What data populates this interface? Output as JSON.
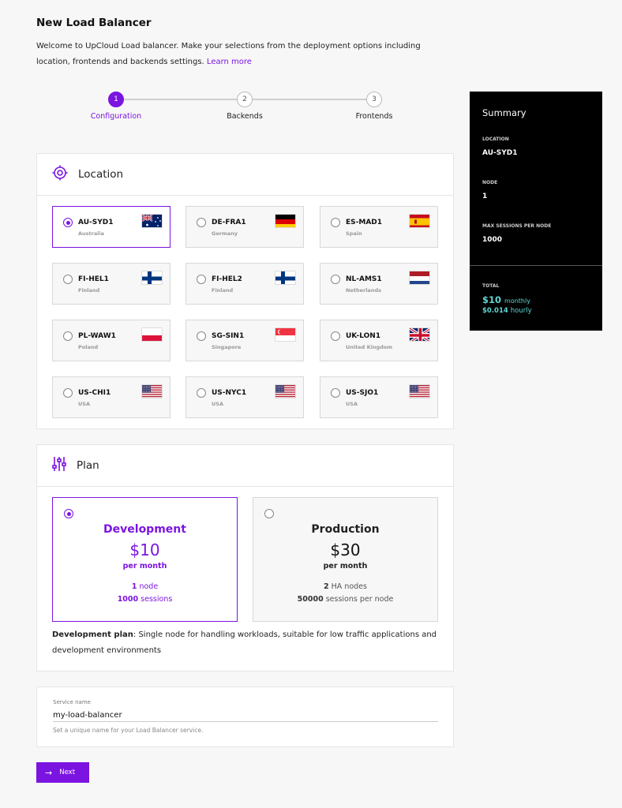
{
  "page": {
    "title": "New Load Balancer",
    "intro": "Welcome to UpCloud Load balancer. Make your selections from the deployment options including location, frontends and backends settings.",
    "learn_more": "Learn more"
  },
  "steps": [
    {
      "num": "1",
      "label": "Configuration",
      "active": true
    },
    {
      "num": "2",
      "label": "Backends",
      "active": false
    },
    {
      "num": "3",
      "label": "Frontends",
      "active": false
    }
  ],
  "location": {
    "heading": "Location",
    "icon": "target-icon",
    "items": [
      {
        "code": "AU-SYD1",
        "country": "Australia",
        "flag": "au",
        "selected": true
      },
      {
        "code": "DE-FRA1",
        "country": "Germany",
        "flag": "de",
        "selected": false
      },
      {
        "code": "ES-MAD1",
        "country": "Spain",
        "flag": "es",
        "selected": false
      },
      {
        "code": "FI-HEL1",
        "country": "Finland",
        "flag": "fi",
        "selected": false
      },
      {
        "code": "FI-HEL2",
        "country": "Finland",
        "flag": "fi",
        "selected": false
      },
      {
        "code": "NL-AMS1",
        "country": "Netherlands",
        "flag": "nl",
        "selected": false
      },
      {
        "code": "PL-WAW1",
        "country": "Poland",
        "flag": "pl",
        "selected": false
      },
      {
        "code": "SG-SIN1",
        "country": "Singapore",
        "flag": "sg",
        "selected": false
      },
      {
        "code": "UK-LON1",
        "country": "United Kingdom",
        "flag": "uk",
        "selected": false
      },
      {
        "code": "US-CHI1",
        "country": "USA",
        "flag": "us",
        "selected": false
      },
      {
        "code": "US-NYC1",
        "country": "USA",
        "flag": "us",
        "selected": false
      },
      {
        "code": "US-SJO1",
        "country": "USA",
        "flag": "us",
        "selected": false
      }
    ]
  },
  "plan": {
    "heading": "Plan",
    "icon": "sliders-icon",
    "options": [
      {
        "name": "Development",
        "price": "$10",
        "per": "per month",
        "line1_num": "1",
        "line1_text": "node",
        "line2_num": "1000",
        "line2_text": "sessions",
        "selected": true
      },
      {
        "name": "Production",
        "price": "$30",
        "per": "per month",
        "line1_num": "2",
        "line1_text": "HA nodes",
        "line2_num": "50000",
        "line2_text": "sessions per node",
        "selected": false
      }
    ],
    "description_label": "Development plan",
    "description": ": Single node for handling workloads, suitable for low traffic applications and development environments"
  },
  "service": {
    "label": "Service name",
    "value": "my-load-balancer",
    "help": "Set a unique name for your Load Balancer service."
  },
  "next_label": "Next",
  "summary": {
    "title": "Summary",
    "location_label": "LOCATION",
    "location_value": "AU-SYD1",
    "node_label": "NODE",
    "node_value": "1",
    "sessions_label": "MAX SESSIONS PER NODE",
    "sessions_value": "1000",
    "total_label": "TOTAL",
    "monthly_price": "$10",
    "monthly_unit": "monthly",
    "hourly_price": "$0.014",
    "hourly_unit": "hourly"
  },
  "colors": {
    "accent": "#7b14e0",
    "summary_price": "#5fd6d1"
  }
}
